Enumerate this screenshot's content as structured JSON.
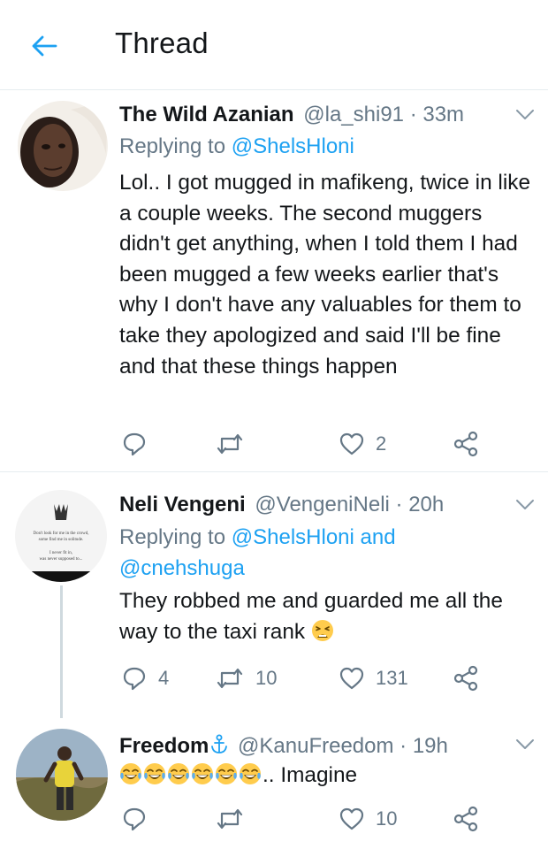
{
  "header": {
    "title": "Thread"
  },
  "tweets": [
    {
      "name": "The Wild Azanian",
      "handle": "@la_shi91",
      "time": "· 33m",
      "reply_prefix": "Replying to ",
      "reply_mentions": "@ShelsHloni",
      "reply_mentions_2": "",
      "text": "Lol.. I got mugged in mafikeng, twice in like a couple weeks. The second muggers didn't get anything, when I told them I had been mugged a few weeks earlier that's why I don't have any valuables for them to take they apologized and said I'll be fine and that these things happen",
      "replies": "",
      "retweets": "",
      "likes": "2"
    },
    {
      "name": "Neli Vengeni",
      "handle": "@VengeniNeli",
      "time": "· 20h",
      "reply_prefix": "Replying to ",
      "reply_mentions": "@ShelsHloni and",
      "reply_mentions_2": "@cnehshuga",
      "text": "They robbed me and guarded me all the way to the taxi rank",
      "avatar_text_1": "Don't look for me in the crowd, some find me in solitude.",
      "avatar_text_2": "I never fit in, was never supposed to...",
      "replies": "4",
      "retweets": "10",
      "likes": "131"
    },
    {
      "name": "Freedom",
      "handle": "@KanuFreedom",
      "time": "· 19h",
      "name_icon": "anchor-icon",
      "text_suffix": ".. Imagine",
      "emoji_count": 6,
      "replies": "",
      "retweets": "",
      "likes": "10"
    }
  ],
  "colors": {
    "accent": "#1da1f2",
    "secondary_text": "#657786",
    "divider": "#e6ecf0",
    "thread_line": "#cfd9de"
  },
  "icons": [
    "back-arrow-icon",
    "chevron-down-icon",
    "reply-icon",
    "retweet-icon",
    "like-icon",
    "share-icon",
    "tired-face-emoji",
    "joy-emoji"
  ]
}
